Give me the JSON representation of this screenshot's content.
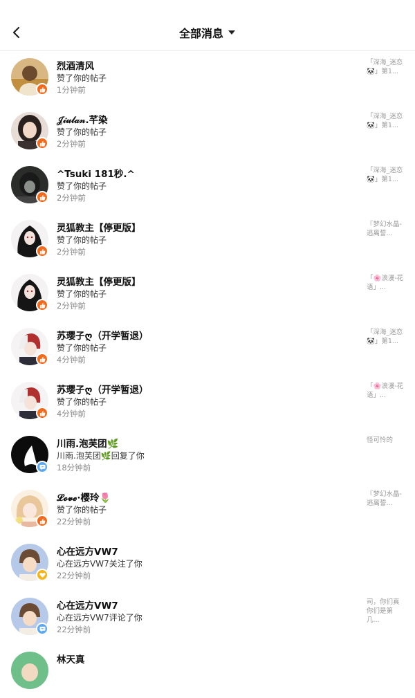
{
  "header": {
    "title": "全部消息",
    "back_icon": "chevron-left-icon",
    "dropdown_icon": "caret-down-icon"
  },
  "colors": {
    "like_badge": "#f26a1b",
    "comment_badge": "#59a8f0",
    "follow_badge": "#f4b41a"
  },
  "messages": [
    {
      "name": "烈酒清风",
      "action": "赞了你的帖子",
      "time": "1分钟前",
      "preview": "「深海_迷恋🐼」第1...",
      "badge": "like"
    },
    {
      "name": "𝒥𝒾𝓊𝓁𝒶𝓃.芊染",
      "action": "赞了你的帖子",
      "time": "2分钟前",
      "preview": "「深海_迷恋🐼」第1...",
      "badge": "like"
    },
    {
      "name": "^Tsuki 181秒.^",
      "action": "赞了你的帖子",
      "time": "2分钟前",
      "preview": "「深海_迷恋🐼」第1...",
      "badge": "like"
    },
    {
      "name": "灵狐教主【停更版】",
      "action": "赞了你的帖子",
      "time": "2分钟前",
      "preview": "『梦幻水晶-逃离誓...",
      "badge": "like"
    },
    {
      "name": "灵狐教主【停更版】",
      "action": "赞了你的帖子",
      "time": "2分钟前",
      "preview": "「🌸浪漫-花语」...",
      "badge": "like"
    },
    {
      "name": "苏璎子ღ（开学暂退）",
      "action": "赞了你的帖子",
      "time": "4分钟前",
      "preview": "「深海_迷恋🐼」第1...",
      "badge": "like"
    },
    {
      "name": "苏璎子ღ（开学暂退）",
      "action": "赞了你的帖子",
      "time": "4分钟前",
      "preview": "「🌸浪漫-花语」...",
      "badge": "like"
    },
    {
      "name": "川雨.泡芙团🌿",
      "action": "川雨.泡芙团🌿回复了你",
      "time": "18分钟前",
      "preview": "怪可怜的",
      "badge": "comment"
    },
    {
      "name": "𝓛𝓸𝓿𝓮·樱玲🌷",
      "action": "赞了你的帖子",
      "time": "22分钟前",
      "preview": "『梦幻水晶-逃离誓...",
      "badge": "like"
    },
    {
      "name": "心在远方VW7",
      "action": "心在远方VW7关注了你",
      "time": "22分钟前",
      "preview": "",
      "badge": "follow"
    },
    {
      "name": "心在远方VW7",
      "action": "心在远方VW7评论了你",
      "time": "22分钟前",
      "preview": "司，你们真你们是第几...",
      "badge": "comment"
    },
    {
      "name": "林天真",
      "action": "",
      "time": "",
      "preview": "",
      "badge": "like"
    }
  ]
}
